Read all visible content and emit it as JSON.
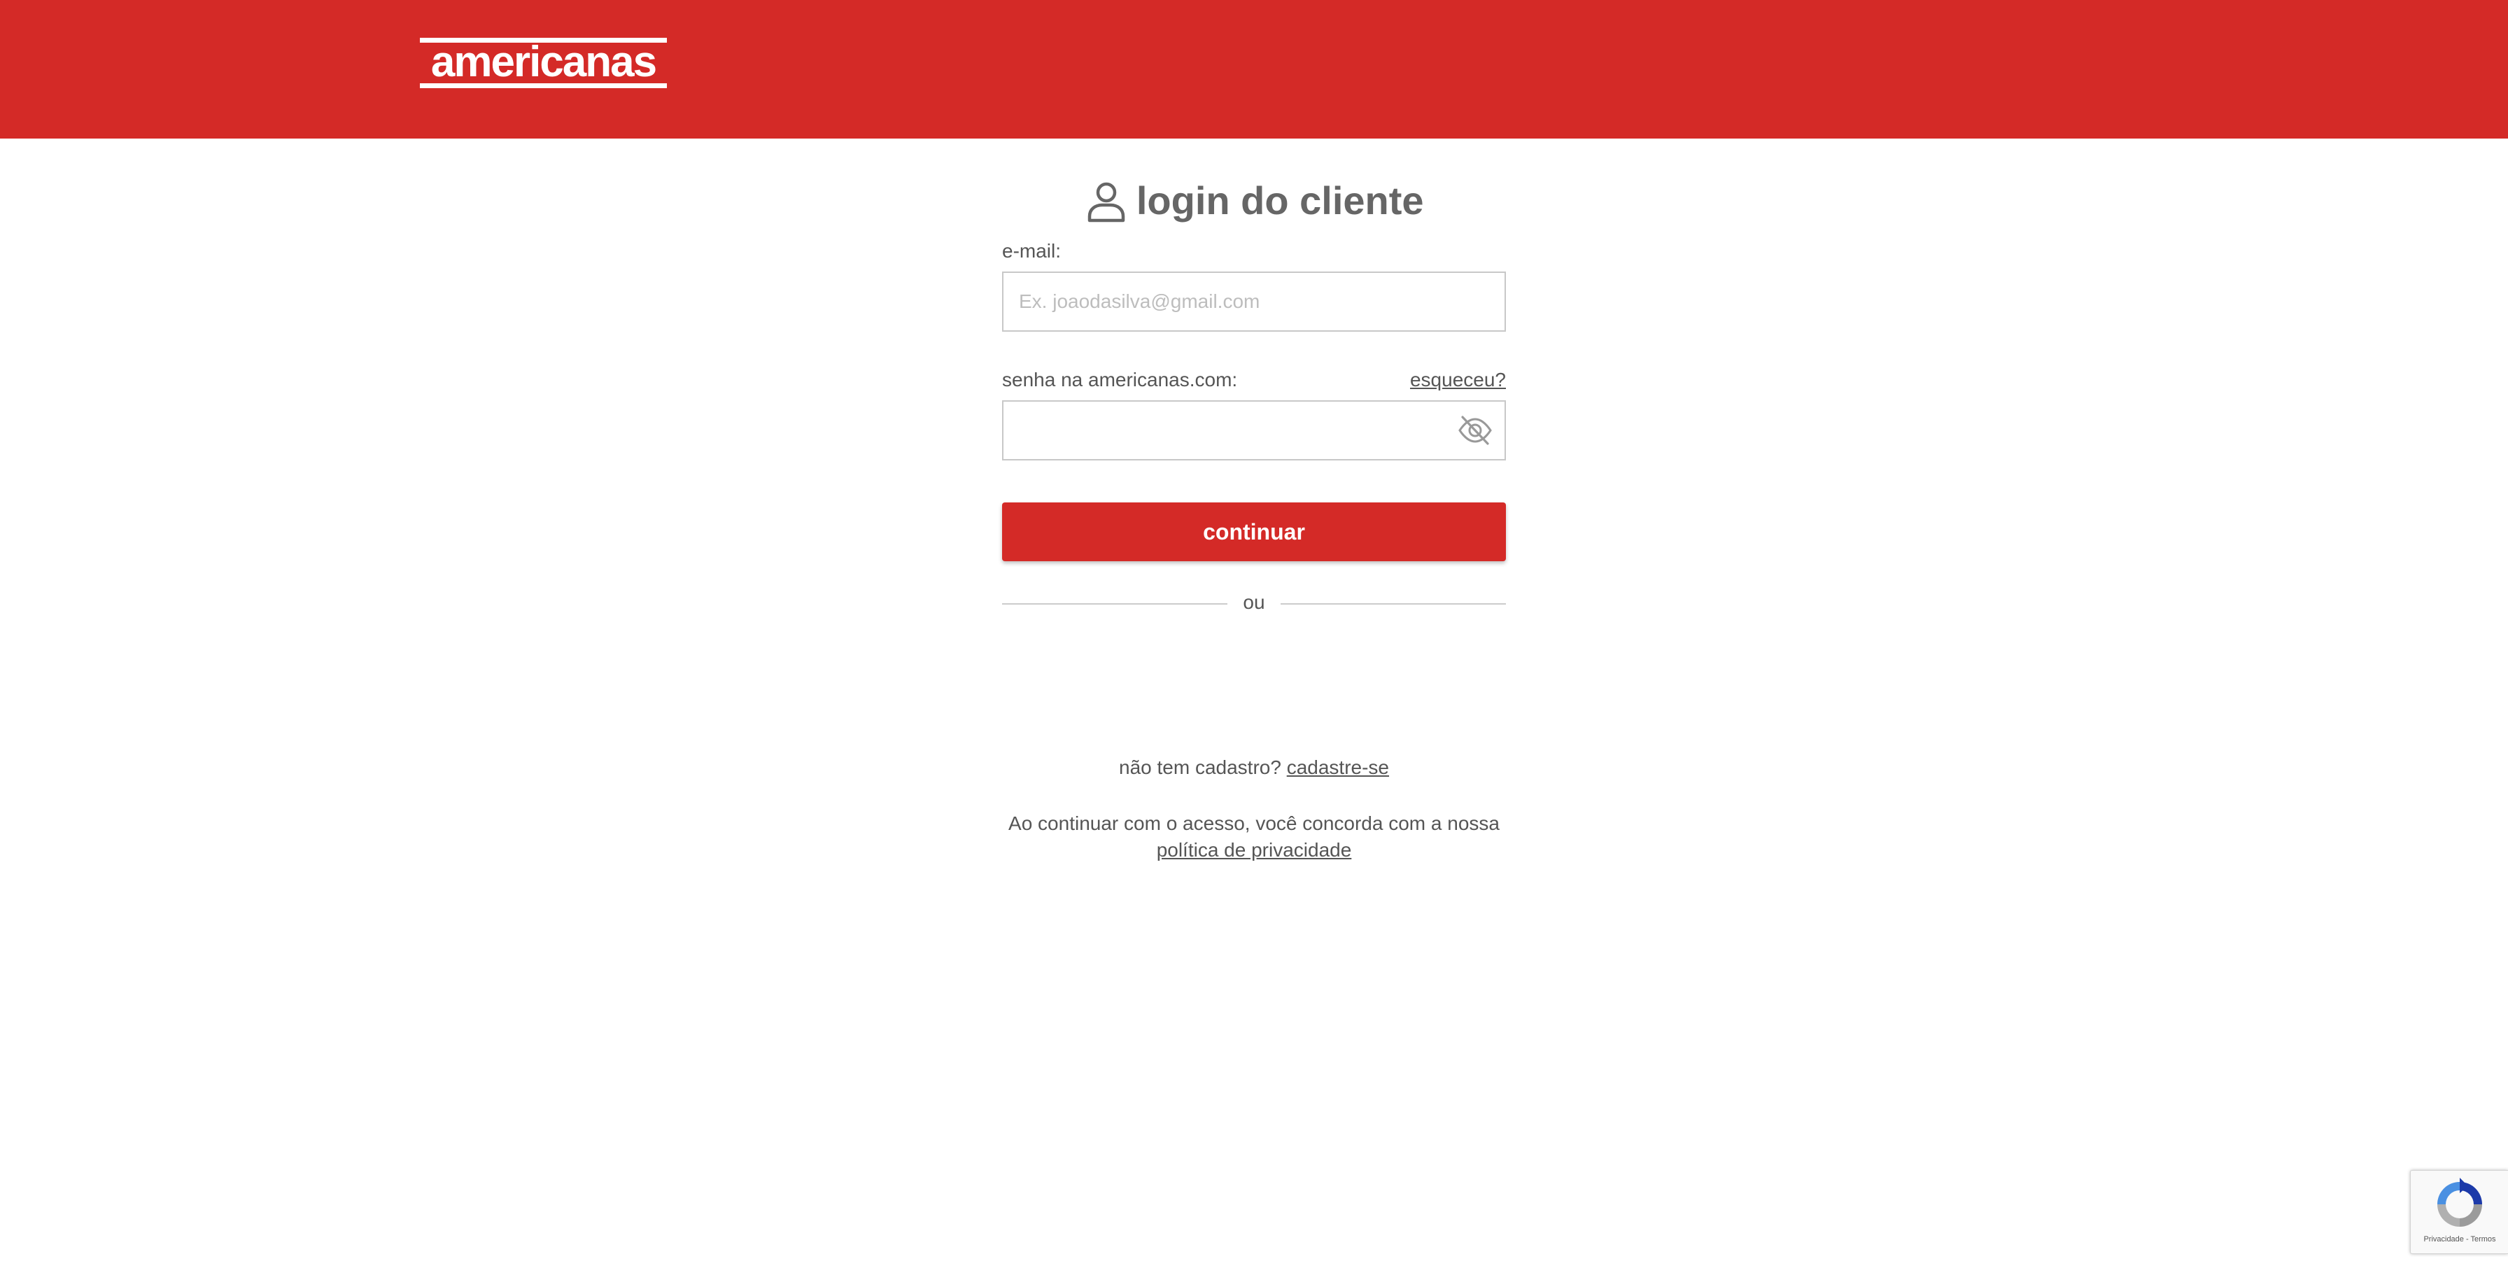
{
  "header": {
    "logo_text": "americanas",
    "brand_color": "#d42a27"
  },
  "login": {
    "title": "login do cliente",
    "title_icon": "user-icon",
    "email": {
      "label": "e-mail:",
      "placeholder": "Ex. joaodasilva@gmail.com",
      "value": ""
    },
    "password": {
      "label": "senha na americanas.com:",
      "forgot_label": "esqueceu?",
      "value": "",
      "toggle_icon": "eye-off-icon"
    },
    "continue_label": "continuar",
    "divider_text": "ou",
    "signup": {
      "prompt": "não tem cadastro?",
      "link_label": "cadastre-se"
    },
    "terms": {
      "text": "Ao continuar com o acesso, você concorda com a nossa",
      "link_label": "política de privacidade"
    }
  },
  "recaptcha": {
    "footer_text": "Privacidade - Termos"
  }
}
